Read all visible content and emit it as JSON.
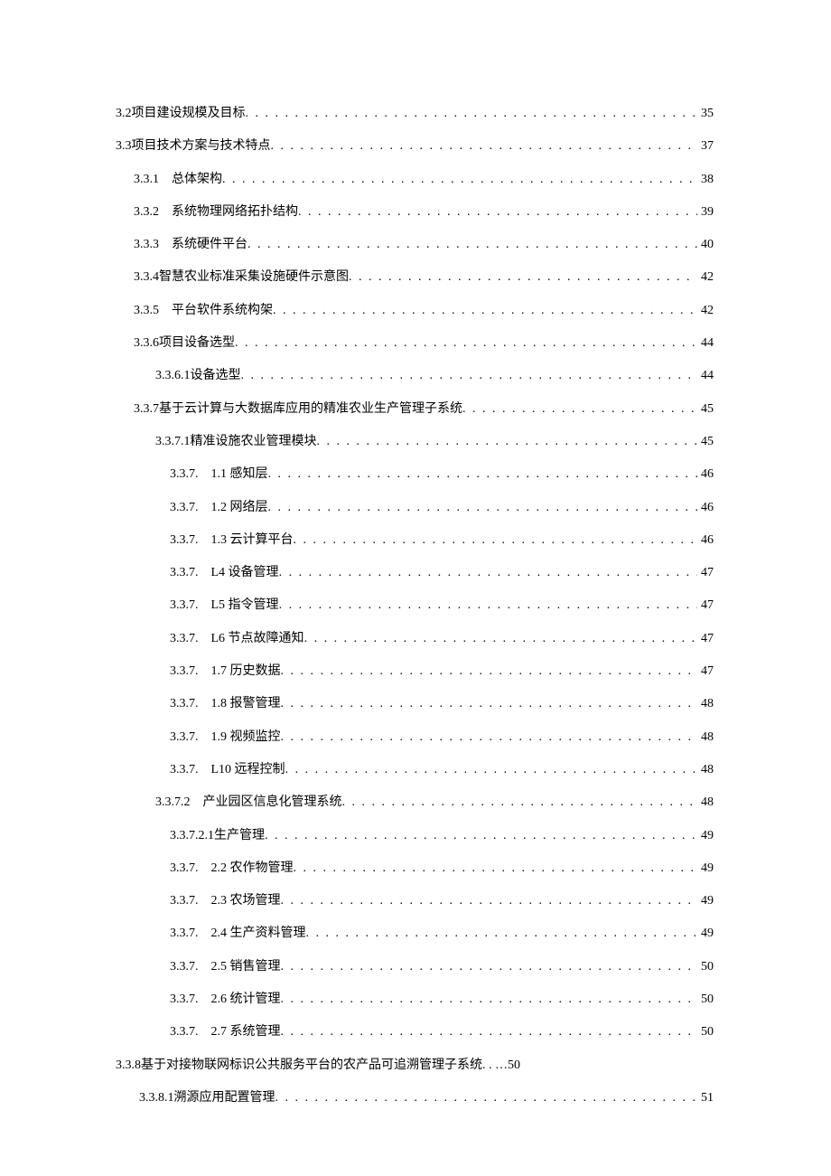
{
  "toc": [
    {
      "indent": 0,
      "number": "3.2",
      "gap": " ",
      "title": "项目建设规模及目标",
      "page": "35",
      "dots": true
    },
    {
      "indent": 0,
      "number": "3.3",
      "gap": " ",
      "title": "项目技术方案与技术特点",
      "page": "37",
      "dots": true
    },
    {
      "indent": 1,
      "number": "3.3.1",
      "gap": "　",
      "title": "总体架构",
      "page": "38",
      "dots": true
    },
    {
      "indent": 1,
      "number": "3.3.2",
      "gap": "　",
      "title": "系统物理网络拓扑结构",
      "page": "39",
      "dots": true
    },
    {
      "indent": 1,
      "number": "3.3.3",
      "gap": "　",
      "title": "系统硬件平台",
      "page": "40",
      "dots": true
    },
    {
      "indent": 1,
      "number": "3.3.4",
      "gap": " ",
      "title": "智慧农业标准采集设施硬件示意图",
      "page": "42",
      "dots": true
    },
    {
      "indent": 1,
      "number": "3.3.5",
      "gap": "　",
      "title": "平台软件系统构架",
      "page": "42",
      "dots": true
    },
    {
      "indent": 1,
      "number": "3.3.6",
      "gap": " ",
      "title": "项目设备选型",
      "page": "44",
      "dots": true
    },
    {
      "indent": 3,
      "number": "3.3.6.1",
      "gap": " ",
      "title": "设备选型",
      "page": "44",
      "dots": true
    },
    {
      "indent": 1,
      "number": "3.3.7",
      "gap": " ",
      "title": "基于云计算与大数据库应用的精准农业生产管理子系统",
      "page": "45",
      "dots": true
    },
    {
      "indent": 3,
      "number": "3.3.7.1",
      "gap": " ",
      "title": "精准设施农业管理模块",
      "page": "45",
      "dots": true
    },
    {
      "indent": 4,
      "number": "3.3.7.",
      "gap": "　",
      "title": "1.1 感知层",
      "page": "46",
      "dots": true
    },
    {
      "indent": 4,
      "number": "3.3.7.",
      "gap": "　",
      "title": "1.2 网络层",
      "page": "46",
      "dots": true
    },
    {
      "indent": 4,
      "number": "3.3.7.",
      "gap": "　",
      "title": "1.3 云计算平台",
      "page": "46",
      "dots": true
    },
    {
      "indent": 4,
      "number": "3.3.7.",
      "gap": "　",
      "title": "L4 设备管理",
      "page": "47",
      "dots": true
    },
    {
      "indent": 4,
      "number": "3.3.7.",
      "gap": "　",
      "title": "L5 指令管理",
      "page": "47",
      "dots": true
    },
    {
      "indent": 4,
      "number": "3.3.7.",
      "gap": "　",
      "title": "L6 节点故障通知",
      "page": "47",
      "dots": true
    },
    {
      "indent": 4,
      "number": "3.3.7.",
      "gap": "　",
      "title": "1.7 历史数据",
      "page": "47",
      "dots": true
    },
    {
      "indent": 4,
      "number": "3.3.7.",
      "gap": "　",
      "title": "1.8 报警管理",
      "page": "48",
      "dots": true
    },
    {
      "indent": 4,
      "number": "3.3.7.",
      "gap": "　",
      "title": "1.9 视频监控",
      "page": "48",
      "dots": true
    },
    {
      "indent": 4,
      "number": "3.3.7.",
      "gap": "　",
      "title": "L10 远程控制",
      "page": "48",
      "dots": true
    },
    {
      "indent": 3,
      "number": "3.3.7.2",
      "gap": "　",
      "title": "产业园区信息化管理系统",
      "page": "48",
      "dots": true
    },
    {
      "indent": 4,
      "number": "3.3.7.2.1",
      "gap": " ",
      "title": "生产管理",
      "page": "49",
      "dots": true
    },
    {
      "indent": 4,
      "number": "3.3.7.",
      "gap": "　",
      "title": "2.2 农作物管理",
      "page": "49",
      "dots": true
    },
    {
      "indent": 4,
      "number": "3.3.7.",
      "gap": "　",
      "title": "2.3 农场管理",
      "page": "49",
      "dots": true
    },
    {
      "indent": 4,
      "number": "3.3.7.",
      "gap": "　",
      "title": "2.4 生产资料管理",
      "page": "49",
      "dots": true
    },
    {
      "indent": 4,
      "number": "3.3.7.",
      "gap": "　",
      "title": "2.5 销售管理",
      "page": "50",
      "dots": true
    },
    {
      "indent": 4,
      "number": "3.3.7.",
      "gap": "　",
      "title": "2.6 统计管理",
      "page": "50",
      "dots": true
    },
    {
      "indent": 4,
      "number": "3.3.7.",
      "gap": "　",
      "title": "2.7 系统管理",
      "page": "50",
      "dots": true
    },
    {
      "indent": 0,
      "number": "3.3.8",
      "gap": " ",
      "title": "基于对接物联网标识公共服务平台的农产品可追溯管理子系统. . …50",
      "page": "",
      "dots": false
    },
    {
      "indent": 2,
      "number": "3.3.8.1",
      "gap": " ",
      "title": "溯源应用配置管理",
      "page": "51",
      "dots": true
    }
  ]
}
